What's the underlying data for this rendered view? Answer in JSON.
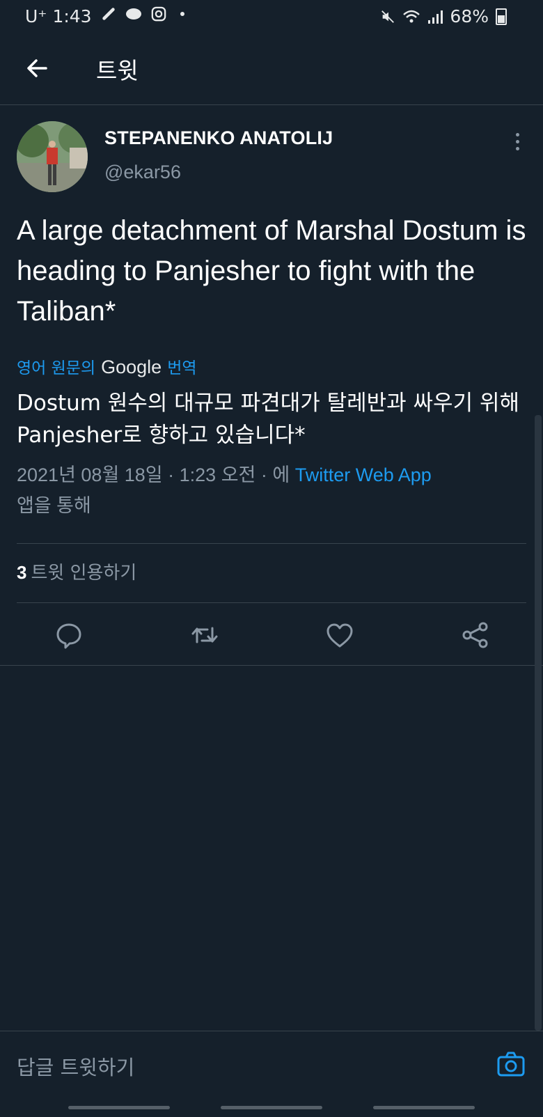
{
  "status_bar": {
    "carrier": "U⁺ 1:43",
    "battery": "68%"
  },
  "header": {
    "title": "트윗"
  },
  "tweet": {
    "display_name": "STEPANENKO ANATOLIJ",
    "username": "@ekar56",
    "text": "A large detachment of Marshal Dostum is heading to Panjesher to fight with the Taliban*",
    "translation_prefix": "영어 원문의",
    "translation_provider": "Google",
    "translation_suffix": "번역",
    "translated_text": "Dostum 원수의 대규모 파견대가 탈레반과 싸우기 위해 Panjesher로 향하고 있습니다*",
    "meta_datetime": "2021년 08월 18일 · 1:23 오전 · 에",
    "meta_source": "Twitter Web App",
    "meta_suffix": "앱을 통해",
    "quote_count": "3",
    "quote_label": "트윗 인용하기"
  },
  "reply_bar": {
    "placeholder": "답글 트윗하기"
  },
  "colors": {
    "background": "#15202b",
    "accent": "#1d9bf0",
    "secondary_text": "#8b98a5",
    "divider": "#38444d"
  },
  "icons": [
    "back-arrow-icon",
    "more-vertical-icon",
    "reply-icon",
    "retweet-icon",
    "like-heart-icon",
    "share-icon",
    "camera-icon"
  ]
}
